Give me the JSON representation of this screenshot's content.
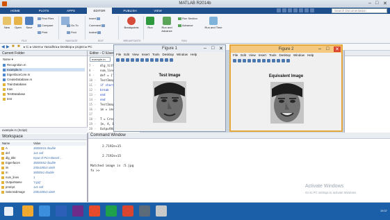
{
  "window": {
    "title": "MATLAB R2014b"
  },
  "tabs": [
    "HOME",
    "PLOTS",
    "APPS",
    "EDITOR",
    "PUBLISH",
    "VIEW"
  ],
  "active_tab": "EDITOR",
  "search": {
    "placeholder": "Search Documentation"
  },
  "ribbon": {
    "new": "New",
    "open": "Open",
    "save": "Save",
    "find_files": "Find Files",
    "compare": "Compare",
    "print": "Print",
    "insert": "Insert",
    "comment": "Comment",
    "indent": "Indent",
    "go_to": "Go To",
    "find": "Find",
    "breakpoints": "Breakpoints",
    "run": "Run",
    "run_and_advance": "Run and Advance",
    "run_section": "Run Section",
    "advance": "Advance",
    "run_and_time": "Run and Time",
    "groups": [
      "FILE",
      "NAVIGATE",
      "EDIT",
      "BREAKPOINTS",
      "RUN"
    ]
  },
  "address": {
    "path": "▸ C: ▸ Users ▸ Yasodhra ▸ Desktop ▸ project ▸ PC"
  },
  "current_folder": {
    "title": "Current Folder",
    "column": "Name",
    "items": [
      "Recognition.m",
      "example.m",
      "EigenfaceCore.m",
      "CreateDatabase.m",
      "TrainDatabase",
      "train",
      "TestDatabase",
      "test"
    ],
    "status": "example.m (Script)"
  },
  "workspace": {
    "title": "Workspace",
    "col_name": "Name",
    "col_value": "Value",
    "rows": [
      {
        "name": "A",
        "value": "36000x31 double"
      },
      {
        "name": "def",
        "value": "1x1 cell"
      },
      {
        "name": "dlg_title",
        "value": "Input of PCA-Based ..."
      },
      {
        "name": "Eigenfaces",
        "value": "36000x52 double"
      },
      {
        "name": "im",
        "value": "200x180x3 uint8"
      },
      {
        "name": "m",
        "value": "36000x1 double"
      },
      {
        "name": "num_lines",
        "value": "1"
      },
      {
        "name": "OutputName",
        "value": "'1.jpg'"
      },
      {
        "name": "prompt",
        "value": "1x1 cell"
      },
      {
        "name": "SelectedImage",
        "value": "200x180x3 uint8"
      }
    ]
  },
  "editor": {
    "title": "Editor - C:\\Users\\",
    "file_tab": "example.m",
    "lines": [
      {
        "n": "7 -",
        "code": "dlg_title"
      },
      {
        "n": "8 -",
        "code": "num_lines"
      },
      {
        "n": "9 -",
        "code": "def = {'1"
      },
      {
        "n": "10 -",
        "code": "TestImage"
      },
      {
        "n": "11 -",
        "code": "if char(T"
      },
      {
        "n": "12 -",
        "code": "break"
      },
      {
        "n": "13 -",
        "code": "end"
      },
      {
        "n": "14 -",
        "code": "end"
      },
      {
        "n": "15 -",
        "code": "TestImage"
      },
      {
        "n": "16 -",
        "code": "im = imre"
      },
      {
        "n": "17",
        "code": ""
      },
      {
        "n": "18 -",
        "code": "T = Creat"
      },
      {
        "n": "19 -",
        "code": "[m, A, Ei"
      },
      {
        "n": "20 -",
        "code": "OutputNam"
      },
      {
        "n": "21",
        "code": ""
      },
      {
        "n": "22 -",
        "code": "SelectedI"
      },
      {
        "n": "23 -",
        "code": "SelectedI"
      }
    ]
  },
  "figure1": {
    "title": "Figure 1",
    "plot_title": "Test Image"
  },
  "figure2": {
    "title": "Figure 2",
    "plot_title": "Equivalent Image"
  },
  "figure_menu": [
    "File",
    "Edit",
    "View",
    "Insert",
    "Tools",
    "Desktop",
    "Window",
    "Help"
  ],
  "command_window": {
    "title": "Command Window",
    "lines": [
      "2.7192e+15",
      "2.7192e+15",
      "Matched image is :5.jpg"
    ],
    "prompt": "fx >>"
  },
  "watermark": {
    "line1": "Activate Windows",
    "line2": "Go to PC settings to activate Windows."
  },
  "taskbar": {
    "time": "19:37"
  }
}
